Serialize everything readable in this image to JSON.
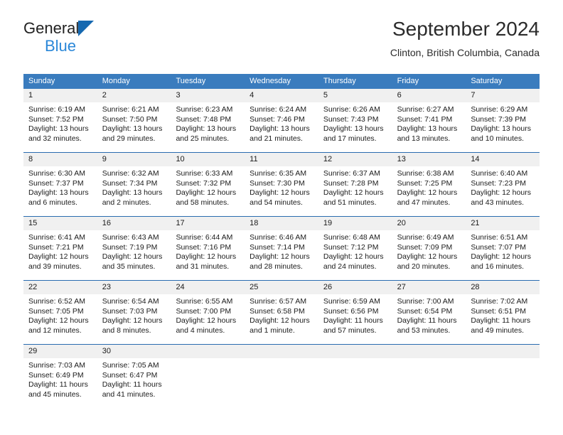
{
  "brand": {
    "name_top": "General",
    "name_bottom": "Blue",
    "triangle_color": "#1568b0",
    "blue_text_color": "#2a87d8"
  },
  "header": {
    "title": "September 2024",
    "subtitle": "Clinton, British Columbia, Canada"
  },
  "colors": {
    "weekday_header_bg": "#3a7cbe",
    "weekday_header_text": "#ffffff",
    "date_band_bg": "#f0f0f0",
    "week_divider": "#2a6cb0",
    "body_text": "#1b1b1b"
  },
  "weekdays": [
    "Sunday",
    "Monday",
    "Tuesday",
    "Wednesday",
    "Thursday",
    "Friday",
    "Saturday"
  ],
  "weeks": [
    [
      {
        "date": "1",
        "lines": [
          "Sunrise: 6:19 AM",
          "Sunset: 7:52 PM",
          "Daylight: 13 hours",
          "and 32 minutes."
        ]
      },
      {
        "date": "2",
        "lines": [
          "Sunrise: 6:21 AM",
          "Sunset: 7:50 PM",
          "Daylight: 13 hours",
          "and 29 minutes."
        ]
      },
      {
        "date": "3",
        "lines": [
          "Sunrise: 6:23 AM",
          "Sunset: 7:48 PM",
          "Daylight: 13 hours",
          "and 25 minutes."
        ]
      },
      {
        "date": "4",
        "lines": [
          "Sunrise: 6:24 AM",
          "Sunset: 7:46 PM",
          "Daylight: 13 hours",
          "and 21 minutes."
        ]
      },
      {
        "date": "5",
        "lines": [
          "Sunrise: 6:26 AM",
          "Sunset: 7:43 PM",
          "Daylight: 13 hours",
          "and 17 minutes."
        ]
      },
      {
        "date": "6",
        "lines": [
          "Sunrise: 6:27 AM",
          "Sunset: 7:41 PM",
          "Daylight: 13 hours",
          "and 13 minutes."
        ]
      },
      {
        "date": "7",
        "lines": [
          "Sunrise: 6:29 AM",
          "Sunset: 7:39 PM",
          "Daylight: 13 hours",
          "and 10 minutes."
        ]
      }
    ],
    [
      {
        "date": "8",
        "lines": [
          "Sunrise: 6:30 AM",
          "Sunset: 7:37 PM",
          "Daylight: 13 hours",
          "and 6 minutes."
        ]
      },
      {
        "date": "9",
        "lines": [
          "Sunrise: 6:32 AM",
          "Sunset: 7:34 PM",
          "Daylight: 13 hours",
          "and 2 minutes."
        ]
      },
      {
        "date": "10",
        "lines": [
          "Sunrise: 6:33 AM",
          "Sunset: 7:32 PM",
          "Daylight: 12 hours",
          "and 58 minutes."
        ]
      },
      {
        "date": "11",
        "lines": [
          "Sunrise: 6:35 AM",
          "Sunset: 7:30 PM",
          "Daylight: 12 hours",
          "and 54 minutes."
        ]
      },
      {
        "date": "12",
        "lines": [
          "Sunrise: 6:37 AM",
          "Sunset: 7:28 PM",
          "Daylight: 12 hours",
          "and 51 minutes."
        ]
      },
      {
        "date": "13",
        "lines": [
          "Sunrise: 6:38 AM",
          "Sunset: 7:25 PM",
          "Daylight: 12 hours",
          "and 47 minutes."
        ]
      },
      {
        "date": "14",
        "lines": [
          "Sunrise: 6:40 AM",
          "Sunset: 7:23 PM",
          "Daylight: 12 hours",
          "and 43 minutes."
        ]
      }
    ],
    [
      {
        "date": "15",
        "lines": [
          "Sunrise: 6:41 AM",
          "Sunset: 7:21 PM",
          "Daylight: 12 hours",
          "and 39 minutes."
        ]
      },
      {
        "date": "16",
        "lines": [
          "Sunrise: 6:43 AM",
          "Sunset: 7:19 PM",
          "Daylight: 12 hours",
          "and 35 minutes."
        ]
      },
      {
        "date": "17",
        "lines": [
          "Sunrise: 6:44 AM",
          "Sunset: 7:16 PM",
          "Daylight: 12 hours",
          "and 31 minutes."
        ]
      },
      {
        "date": "18",
        "lines": [
          "Sunrise: 6:46 AM",
          "Sunset: 7:14 PM",
          "Daylight: 12 hours",
          "and 28 minutes."
        ]
      },
      {
        "date": "19",
        "lines": [
          "Sunrise: 6:48 AM",
          "Sunset: 7:12 PM",
          "Daylight: 12 hours",
          "and 24 minutes."
        ]
      },
      {
        "date": "20",
        "lines": [
          "Sunrise: 6:49 AM",
          "Sunset: 7:09 PM",
          "Daylight: 12 hours",
          "and 20 minutes."
        ]
      },
      {
        "date": "21",
        "lines": [
          "Sunrise: 6:51 AM",
          "Sunset: 7:07 PM",
          "Daylight: 12 hours",
          "and 16 minutes."
        ]
      }
    ],
    [
      {
        "date": "22",
        "lines": [
          "Sunrise: 6:52 AM",
          "Sunset: 7:05 PM",
          "Daylight: 12 hours",
          "and 12 minutes."
        ]
      },
      {
        "date": "23",
        "lines": [
          "Sunrise: 6:54 AM",
          "Sunset: 7:03 PM",
          "Daylight: 12 hours",
          "and 8 minutes."
        ]
      },
      {
        "date": "24",
        "lines": [
          "Sunrise: 6:55 AM",
          "Sunset: 7:00 PM",
          "Daylight: 12 hours",
          "and 4 minutes."
        ]
      },
      {
        "date": "25",
        "lines": [
          "Sunrise: 6:57 AM",
          "Sunset: 6:58 PM",
          "Daylight: 12 hours",
          "and 1 minute."
        ]
      },
      {
        "date": "26",
        "lines": [
          "Sunrise: 6:59 AM",
          "Sunset: 6:56 PM",
          "Daylight: 11 hours",
          "and 57 minutes."
        ]
      },
      {
        "date": "27",
        "lines": [
          "Sunrise: 7:00 AM",
          "Sunset: 6:54 PM",
          "Daylight: 11 hours",
          "and 53 minutes."
        ]
      },
      {
        "date": "28",
        "lines": [
          "Sunrise: 7:02 AM",
          "Sunset: 6:51 PM",
          "Daylight: 11 hours",
          "and 49 minutes."
        ]
      }
    ],
    [
      {
        "date": "29",
        "lines": [
          "Sunrise: 7:03 AM",
          "Sunset: 6:49 PM",
          "Daylight: 11 hours",
          "and 45 minutes."
        ]
      },
      {
        "date": "30",
        "lines": [
          "Sunrise: 7:05 AM",
          "Sunset: 6:47 PM",
          "Daylight: 11 hours",
          "and 41 minutes."
        ]
      },
      {
        "date": "",
        "lines": []
      },
      {
        "date": "",
        "lines": []
      },
      {
        "date": "",
        "lines": []
      },
      {
        "date": "",
        "lines": []
      },
      {
        "date": "",
        "lines": []
      }
    ]
  ]
}
